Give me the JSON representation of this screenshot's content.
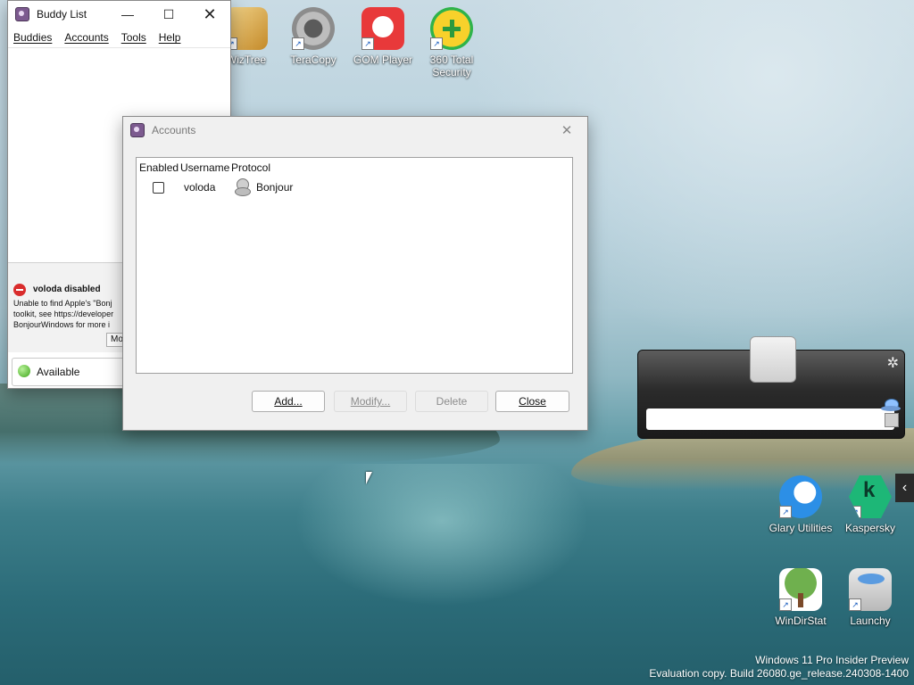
{
  "desktop": {
    "icons": [
      {
        "label": "WizTree",
        "color": "#d9a441"
      },
      {
        "label": "TeraCopy",
        "color": "#8a8a8a"
      },
      {
        "label": "GOM Player",
        "color": "#e8393a"
      },
      {
        "label": "360 Total Security",
        "color": "#f4c21b"
      },
      {
        "label": "Glary Utilities",
        "color": "#2c8fe6"
      },
      {
        "label": "Kaspersky",
        "color": "#1db777"
      },
      {
        "label": "WinDirStat",
        "color": "#4c8d35"
      },
      {
        "label": "Launchy",
        "color": "#cfcfcf"
      }
    ],
    "watermark_line1": "Windows 11 Pro Insider Preview",
    "watermark_line2": "Evaluation copy. Build 26080.ge_release.240308-1400"
  },
  "buddy_list": {
    "title": "Buddy List",
    "menus": [
      "Buddies",
      "Accounts",
      "Tools",
      "Help"
    ],
    "notice_title": "voloda disabled",
    "notice_line1": "Unable to find Apple's \"Bonj",
    "notice_line2": "toolkit, see https://developer",
    "notice_line3": "BonjourWindows for more i",
    "notice_button": "Mo",
    "status": "Available"
  },
  "accounts": {
    "title": "Accounts",
    "columns": [
      "Enabled",
      "Username",
      "Protocol"
    ],
    "rows": [
      {
        "enabled": false,
        "username": "voloda",
        "protocol": "Bonjour"
      }
    ],
    "buttons": {
      "add": "Add...",
      "modify": "Modify...",
      "delete": "Delete",
      "close": "Close"
    }
  }
}
